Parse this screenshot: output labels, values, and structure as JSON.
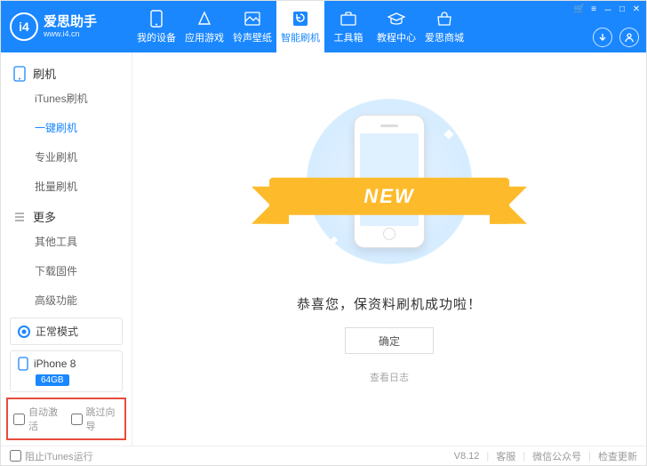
{
  "brand": {
    "name": "爱思助手",
    "url": "www.i4.cn",
    "logo_text": "i4"
  },
  "nav": {
    "items": [
      {
        "label": "我的设备"
      },
      {
        "label": "应用游戏"
      },
      {
        "label": "铃声壁纸"
      },
      {
        "label": "智能刷机",
        "active": true
      },
      {
        "label": "工具箱"
      },
      {
        "label": "教程中心"
      },
      {
        "label": "爱思商城"
      }
    ]
  },
  "sidebar": {
    "group1": {
      "title": "刷机",
      "icon": "phone-icon",
      "items": [
        {
          "label": "iTunes刷机"
        },
        {
          "label": "一键刷机",
          "active": true
        },
        {
          "label": "专业刷机"
        },
        {
          "label": "批量刷机"
        }
      ]
    },
    "group2": {
      "title": "更多",
      "icon": "list-icon",
      "items": [
        {
          "label": "其他工具"
        },
        {
          "label": "下载固件"
        },
        {
          "label": "高级功能"
        }
      ]
    },
    "mode_label": "正常模式",
    "device": {
      "name": "iPhone 8",
      "capacity": "64GB"
    },
    "options": {
      "auto_activate": "自动激活",
      "skip_guide": "跳过向导"
    }
  },
  "main": {
    "ribbon_text": "NEW",
    "success_text": "恭喜您，保资料刷机成功啦！",
    "ok_label": "确定",
    "log_link": "查看日志"
  },
  "footer": {
    "block_itunes": "阻止iTunes运行",
    "version": "V8.12",
    "support": "客服",
    "wechat": "微信公众号",
    "update": "检查更新"
  }
}
